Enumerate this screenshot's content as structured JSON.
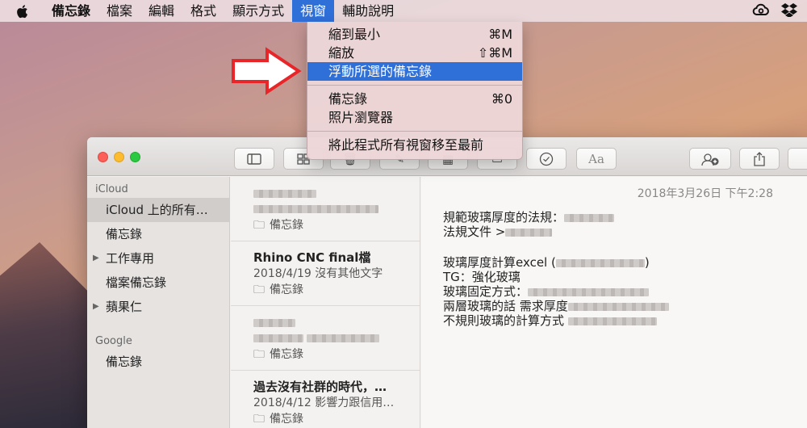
{
  "menubar": {
    "apple_icon": "apple-icon",
    "items": [
      "備忘錄",
      "檔案",
      "編輯",
      "格式",
      "顯示方式",
      "視窗",
      "輔助說明"
    ],
    "active_index": 5,
    "status_icons": [
      "creative-cloud-icon",
      "dropbox-icon"
    ]
  },
  "window_menu": {
    "items": [
      {
        "label": "縮到最小",
        "shortcut": "⌘M"
      },
      {
        "label": "縮放",
        "shortcut": "⇧⌘M"
      },
      {
        "label": "浮動所選的備忘錄",
        "shortcut": ""
      },
      {
        "label": "備忘錄",
        "shortcut": "⌘0"
      },
      {
        "label": "照片瀏覽器",
        "shortcut": ""
      },
      {
        "label": "將此程式所有視窗移至最前",
        "shortcut": ""
      }
    ],
    "highlighted_index": 2
  },
  "sidebar": {
    "sections": [
      {
        "title": "iCloud",
        "items": [
          {
            "label": "iCloud 上的所有…",
            "selected": true,
            "expandable": false
          },
          {
            "label": "備忘錄",
            "selected": false,
            "expandable": false
          },
          {
            "label": "工作專用",
            "selected": false,
            "expandable": true
          },
          {
            "label": "檔案備忘錄",
            "selected": false,
            "expandable": false
          },
          {
            "label": "蘋果仁",
            "selected": false,
            "expandable": true
          }
        ]
      },
      {
        "title": "Google",
        "items": [
          {
            "label": "備忘錄",
            "selected": false,
            "expandable": false
          }
        ]
      }
    ]
  },
  "notes": [
    {
      "title": "",
      "meta": "",
      "folder": "備忘錄",
      "blurred": true
    },
    {
      "title": "Rhino CNC final檔",
      "meta": "2018/4/19  沒有其他文字",
      "folder": "備忘錄",
      "blurred": false
    },
    {
      "title": "",
      "meta": "",
      "folder": "備忘錄",
      "blurred": true
    },
    {
      "title": "過去沒有社群的時代，…",
      "meta": "2018/4/12  影響力跟信用…",
      "folder": "備忘錄",
      "blurred": false
    }
  ],
  "editor": {
    "date": "2018年3月26日 下午2:28",
    "lines": [
      "規範玻璃厚度的法規：",
      "法規文件 >",
      "",
      "玻璃厚度計算excel (",
      "TG：強化玻璃",
      "玻璃固定方式：",
      "兩層玻璃的話 需求厚度",
      "不規則玻璃的計算方式"
    ],
    "line_tail": {
      "3": ")"
    }
  },
  "colors": {
    "highlight": "#2f6fd8",
    "arrow": "#e8262a"
  }
}
